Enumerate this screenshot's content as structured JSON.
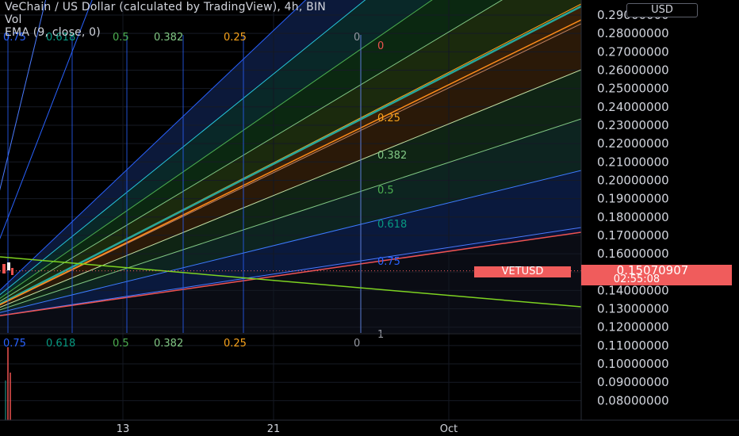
{
  "legend": {
    "title": "VeChain / US Dollar (calculated by TradingView), 4h, BIN",
    "vol": "Vol",
    "ema": "EMA (9, close, 0)"
  },
  "currency": "USD",
  "symbol": "VETUSD",
  "last_price": "0.15070907",
  "countdown": "02:55:08",
  "colors": {
    "background": "#000000",
    "grid": "#1e222d",
    "price_tag": "#f05c5c",
    "teal_line": "#26a69a",
    "ema": "#7ed321"
  },
  "chart_data": {
    "type": "line",
    "title": "VeChain / US Dollar (calculated by TradingView), 4h, BIN",
    "price_axis": {
      "ticks": [
        "0.29000000",
        "0.28000000",
        "0.27000000",
        "0.26000000",
        "0.25000000",
        "0.24000000",
        "0.23000000",
        "0.22000000",
        "0.21000000",
        "0.20000000",
        "0.19000000",
        "0.18000000",
        "0.17000000",
        "0.16000000",
        "0.15000000",
        "0.14000000",
        "0.13000000",
        "0.12000000",
        "0.11000000",
        "0.10000000",
        "0.09000000",
        "0.08000000"
      ],
      "range": [
        0.075,
        0.292
      ]
    },
    "time_axis": {
      "ticks": [
        "13",
        "21",
        "Oct"
      ]
    },
    "gann_fan": {
      "top_levels": [
        "0.75",
        "0.618",
        "0.5",
        "0.382",
        "0.25",
        "0"
      ],
      "right_levels": [
        "0",
        "0.25",
        "0.382",
        "0.5",
        "0.618",
        "0.75",
        "1"
      ],
      "bottom_levels": [
        "0.75",
        "0.618",
        "0.5",
        "0.382",
        "0.25",
        "0"
      ],
      "level_colors": {
        "0": "#808080",
        "0.25": "#f7a21b",
        "0.382": "#81c784",
        "0.5": "#4caf50",
        "0.618": "#089981",
        "0.75": "#2962ff",
        "1": "#9598a1"
      }
    },
    "last_price": 0.15070907,
    "ema_line": {
      "name": "EMA (9, close, 0)"
    },
    "legend_placement": "top-left"
  }
}
